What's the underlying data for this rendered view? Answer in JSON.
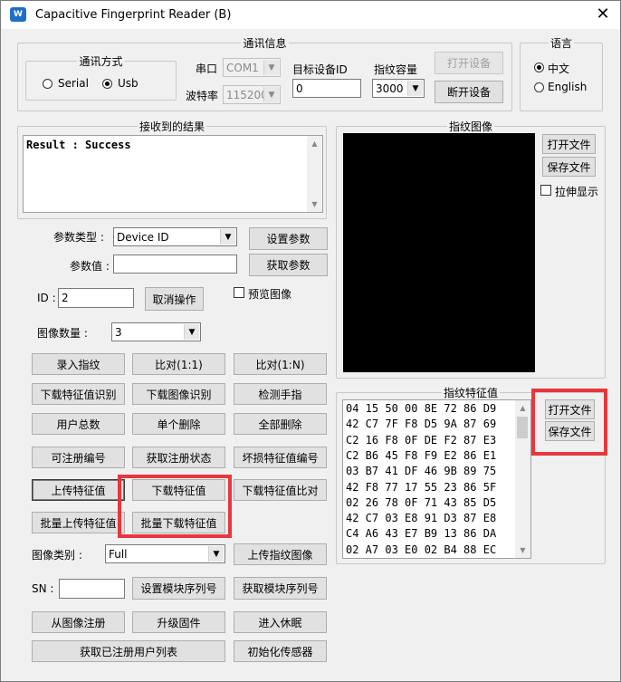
{
  "window": {
    "title": "Capacitive Fingerprint Reader (B)",
    "close_glyph": "✕",
    "app_icon": "W"
  },
  "comm": {
    "title": "通讯信息",
    "mode_title": "通讯方式",
    "serial_label": "Serial",
    "usb_label": "Usb",
    "selected_mode": "Usb",
    "port_label": "串口",
    "port_value": "COM1",
    "baud_label": "波特率",
    "baud_value": "115200",
    "target_id_label": "目标设备ID",
    "target_id_value": "0",
    "capacity_label": "指纹容量",
    "capacity_value": "3000",
    "open_device": "打开设备",
    "close_device": "断开设备"
  },
  "language": {
    "title": "语言",
    "chinese": "中文",
    "english": "English",
    "selected": "中文"
  },
  "result": {
    "title": "接收到的结果",
    "text": "Result : Success"
  },
  "image_panel": {
    "title": "指纹图像",
    "open_file": "打开文件",
    "save_file": "保存文件",
    "stretch_label": "拉伸显示"
  },
  "params": {
    "type_label": "参数类型 :",
    "type_value": "Device ID",
    "value_label": "参数值 :",
    "value_value": "",
    "set_param": "设置参数",
    "get_param": "获取参数",
    "id_label": "ID :",
    "id_value": "2",
    "cancel": "取消操作",
    "preview_label": "预览图像",
    "image_count_label": "图像数量 :",
    "image_count_value": "3"
  },
  "buttons": {
    "enroll": "录入指纹",
    "match_11": "比对(1:1)",
    "match_1n": "比对(1:N)",
    "download_feature_identify": "下载特征值识别",
    "download_image_identify": "下载图像识别",
    "detect_finger": "检测手指",
    "user_total": "用户总数",
    "delete_single": "单个删除",
    "delete_all": "全部删除",
    "enrollable_id": "可注册编号",
    "get_enroll_status": "获取注册状态",
    "bad_feature_ids": "坏损特征值编号",
    "upload_feature": "上传特征值",
    "download_feature": "下载特征值",
    "download_feature_compare": "下载特征值比对",
    "batch_upload_feature": "批量上传特征值",
    "batch_download_feature": "批量下载特征值",
    "upload_fp_image": "上传指纹图像",
    "set_serial": "设置模块序列号",
    "get_serial": "获取模块序列号",
    "enroll_from_image": "从图像注册",
    "upgrade_firmware": "升级固件",
    "enter_sleep": "进入休眠",
    "get_enrolled_list": "获取已注册用户列表",
    "init_sensor": "初始化传感器"
  },
  "image_type": {
    "label": "图像类别 :",
    "value": "Full"
  },
  "sn": {
    "label": "SN :",
    "value": ""
  },
  "feature": {
    "title": "指纹特征值",
    "open_file": "打开文件",
    "save_file": "保存文件",
    "lines": [
      "04 15 50 00 8E 72 86 D9",
      "42 C7 7F F8 D5 9A 87 69",
      "C2 16 F8 0F DE F2 87 E3",
      "C2 B6 45 F8 F9 E2 86 E1",
      "03 B7 41 DF 46 9B 89 75",
      "42 F8 77 17 55 23 86 5F",
      "02 26 78 0F 71 43 85 D5",
      "42 C7 03 E8 91 D3 87 E8",
      "C4 A6 43 E7 B9 13 86 DA",
      "02 A7 03 E0 02 B4 88 EC"
    ]
  },
  "colors": {
    "highlight": "#e8373c",
    "image_bg": "#000000",
    "window_bg": "#f0f0f0"
  }
}
